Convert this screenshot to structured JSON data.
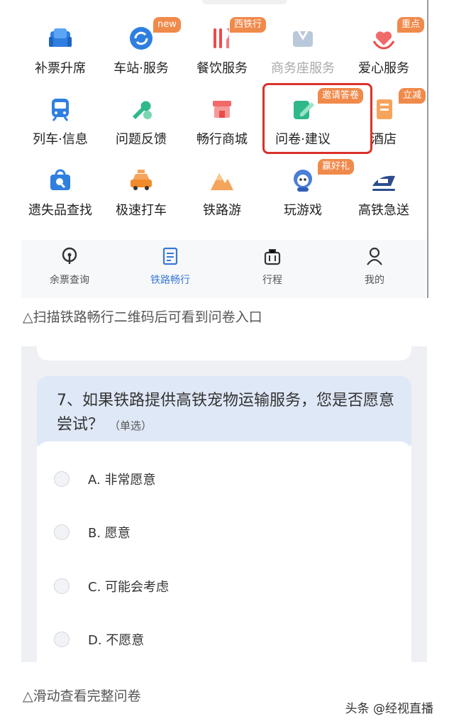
{
  "services": [
    {
      "label": "补票升席",
      "icon": "seat-upgrade-icon",
      "badge": ""
    },
    {
      "label": "车站·服务",
      "icon": "station-service-icon",
      "badge": "new"
    },
    {
      "label": "餐饮服务",
      "icon": "dining-icon",
      "badge": "西铁行"
    },
    {
      "label": "商务座服务",
      "icon": "business-seat-icon",
      "badge": "",
      "disabled": true
    },
    {
      "label": "爱心服务",
      "icon": "care-heart-icon",
      "badge": "重点"
    },
    {
      "label": "列车·信息",
      "icon": "train-info-icon",
      "badge": ""
    },
    {
      "label": "问题反馈",
      "icon": "feedback-wrench-icon",
      "badge": ""
    },
    {
      "label": "畅行商城",
      "icon": "mall-shop-icon",
      "badge": ""
    },
    {
      "label": "问卷·建议",
      "icon": "survey-edit-icon",
      "badge": "邀请答卷"
    },
    {
      "label": "酒店",
      "icon": "hotel-icon",
      "badge": "立减"
    },
    {
      "label": "遗失品查找",
      "icon": "lost-found-bag-icon",
      "badge": ""
    },
    {
      "label": "极速打车",
      "icon": "taxi-icon",
      "badge": ""
    },
    {
      "label": "铁路游",
      "icon": "railway-tour-mountain-icon",
      "badge": ""
    },
    {
      "label": "玩游戏",
      "icon": "game-mascot-icon",
      "badge": "赢好礼"
    },
    {
      "label": "高铁急送",
      "icon": "express-delivery-icon",
      "badge": ""
    }
  ],
  "tabbar": [
    {
      "label": "余票查询",
      "icon": "ticket-query-icon",
      "active": false
    },
    {
      "label": "铁路畅行",
      "icon": "railway-pass-icon",
      "active": true
    },
    {
      "label": "行程",
      "icon": "itinerary-bag-icon",
      "active": false
    },
    {
      "label": "我的",
      "icon": "profile-person-icon",
      "active": false
    }
  ],
  "captions": {
    "first": "△扫描铁路畅行二维码后可看到问卷入口",
    "second": "△滑动查看完整问卷"
  },
  "question": {
    "title": "7、如果铁路提供高铁宠物运输服务，您是否愿意尝试？",
    "type": "（单选）",
    "options": [
      "A.  非常愿意",
      "B.  愿意",
      "C.  可能会考虑",
      "D.  不愿意"
    ]
  },
  "watermark": "头条 @经视直播",
  "colors": {
    "highlight": "#d9332b",
    "active_tab": "#3a78d4",
    "badge": "#f08a4b"
  }
}
